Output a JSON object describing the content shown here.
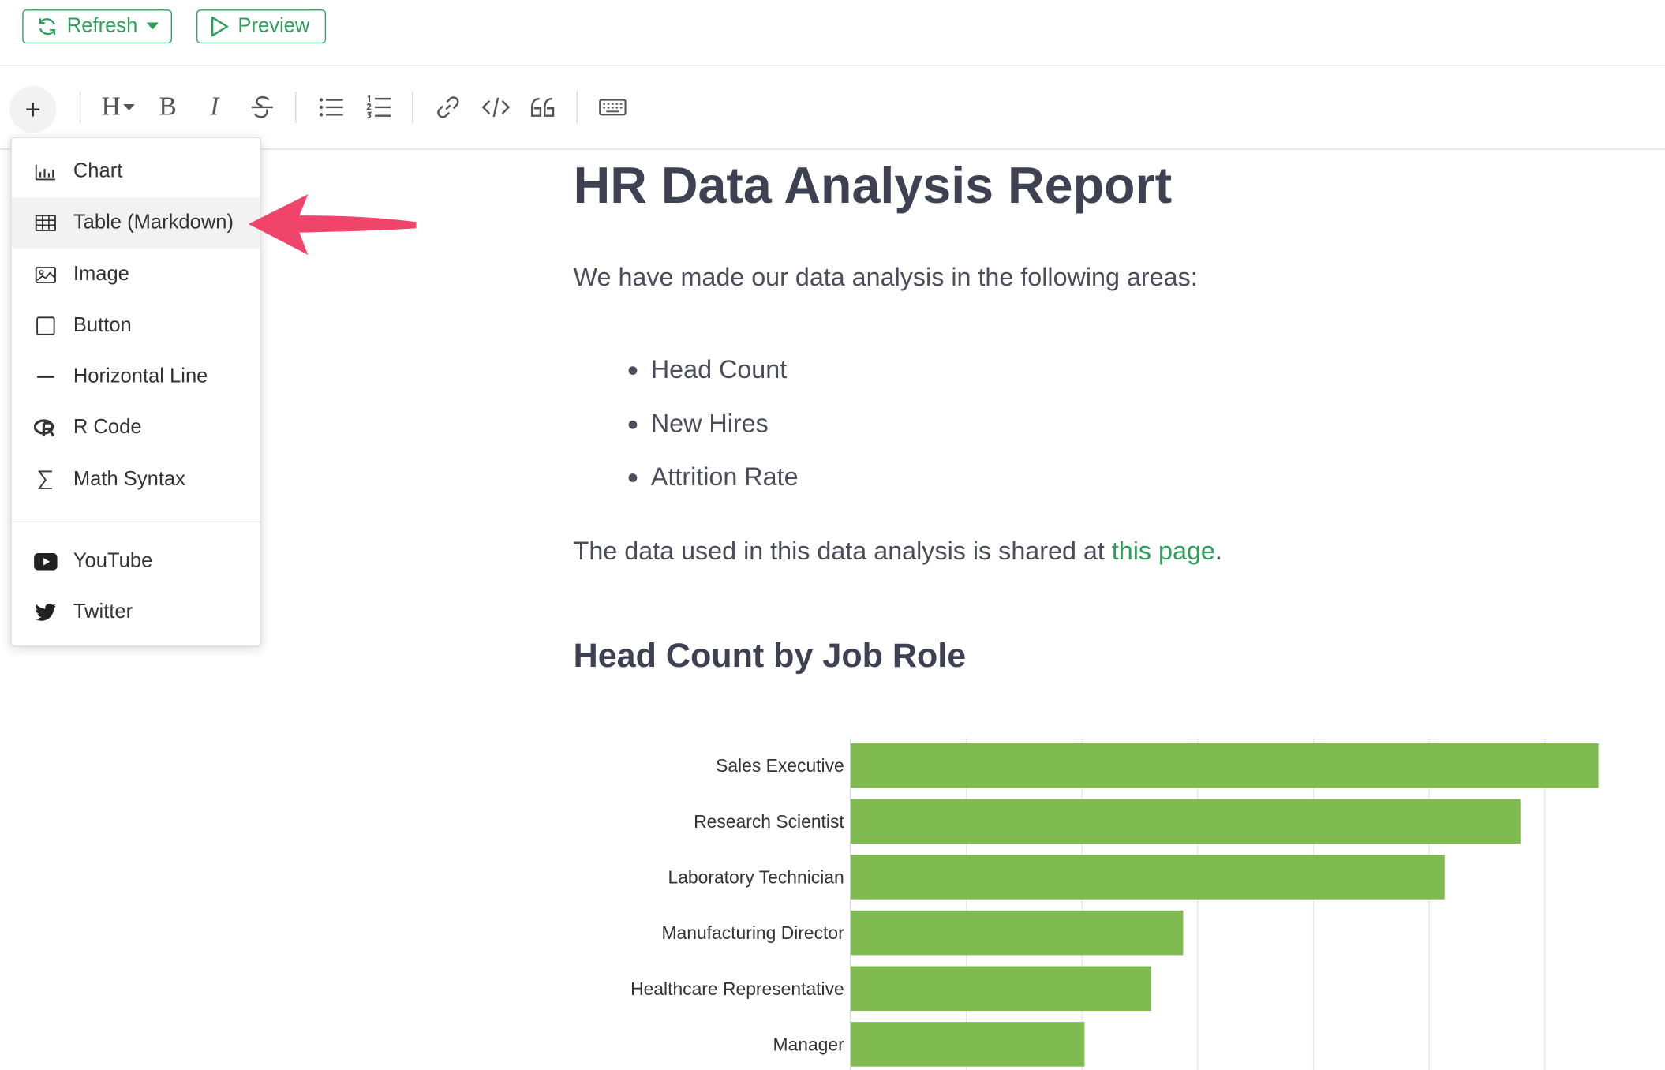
{
  "topbar": {
    "refresh_label": "Refresh",
    "preview_label": "Preview"
  },
  "toolbar": {
    "plus_label": "+",
    "heading_label": "H",
    "bold_label": "B",
    "italic_label": "I"
  },
  "insert_menu": {
    "items": [
      {
        "label": "Chart",
        "icon": "chart-icon"
      },
      {
        "label": "Table (Markdown)",
        "icon": "table-icon"
      },
      {
        "label": "Image",
        "icon": "image-icon"
      },
      {
        "label": "Button",
        "icon": "button-icon"
      },
      {
        "label": "Horizontal Line",
        "icon": "horizontal-line-icon"
      },
      {
        "label": "R Code",
        "icon": "r-logo-icon"
      },
      {
        "label": "Math Syntax",
        "icon": "sigma-icon"
      },
      {
        "label": "YouTube",
        "icon": "youtube-icon"
      },
      {
        "label": "Twitter",
        "icon": "twitter-icon"
      }
    ],
    "highlighted": "Table (Markdown)"
  },
  "document": {
    "title": "HR Data Analysis Report",
    "intro": "We have made our data analysis in the following areas:",
    "bullets": [
      "Head Count",
      "New Hires",
      "Attrition Rate"
    ],
    "data_note_prefix": "The data used in this data analysis is shared at ",
    "data_note_link": "this page",
    "data_note_suffix": ".",
    "section_title": "Head Count by Job Role"
  },
  "colors": {
    "accent": "#2e9e5b",
    "bar": "#80bb52",
    "arrow": "#f0446b",
    "heading": "#3e4152"
  },
  "chart_data": {
    "type": "bar",
    "orientation": "horizontal",
    "categories": [
      "Sales Executive",
      "Research Scientist",
      "Laboratory Technician",
      "Manufacturing Director",
      "Healthcare Representative",
      "Manager"
    ],
    "values": [
      326,
      292,
      259,
      145,
      131,
      102
    ],
    "xlim": [
      0,
      330
    ],
    "grid": true
  }
}
